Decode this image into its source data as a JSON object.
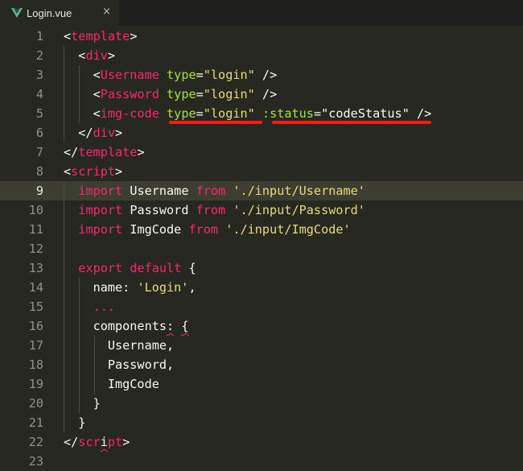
{
  "tab": {
    "title": "Login.vue",
    "close_glyph": "×",
    "icon": "vue-logo-icon"
  },
  "colors": {
    "background": "#272822",
    "keyword": "#f92672",
    "attribute": "#a6e22e",
    "string": "#e6db74",
    "text": "#f8f8f2",
    "highlight_underline": "#ff1a1a"
  },
  "active_line": 9,
  "lines": [
    {
      "n": "1",
      "tokens": [
        [
          "t",
          "<"
        ],
        [
          "p",
          "template"
        ],
        [
          "t",
          ">"
        ]
      ]
    },
    {
      "n": "2",
      "tokens": [
        [
          "t",
          "  <"
        ],
        [
          "p",
          "div"
        ],
        [
          "t",
          ">"
        ]
      ]
    },
    {
      "n": "3",
      "tokens": [
        [
          "t",
          "    <"
        ],
        [
          "p",
          "Username"
        ],
        [
          "t",
          " "
        ],
        [
          "g",
          "type"
        ],
        [
          "t",
          "="
        ],
        [
          "y",
          "\"login\""
        ],
        [
          "t",
          " />"
        ]
      ]
    },
    {
      "n": "4",
      "tokens": [
        [
          "t",
          "    <"
        ],
        [
          "p",
          "Password"
        ],
        [
          "t",
          " "
        ],
        [
          "g",
          "type"
        ],
        [
          "t",
          "="
        ],
        [
          "y",
          "\"login\""
        ],
        [
          "t",
          " />"
        ]
      ]
    },
    {
      "n": "5",
      "tokens": [
        [
          "t",
          "    <"
        ],
        [
          "p",
          "img-code"
        ],
        [
          "t",
          " "
        ],
        [
          "g",
          "type"
        ],
        [
          "t",
          "="
        ],
        [
          "y",
          "\"login\""
        ],
        [
          "t",
          " "
        ],
        [
          "g",
          ":status"
        ],
        [
          "t",
          "=\""
        ],
        [
          "t",
          "codeStatus"
        ],
        [
          "t",
          "\" />"
        ]
      ]
    },
    {
      "n": "6",
      "tokens": [
        [
          "t",
          "  </"
        ],
        [
          "p",
          "div"
        ],
        [
          "t",
          ">"
        ]
      ]
    },
    {
      "n": "7",
      "tokens": [
        [
          "t",
          "</"
        ],
        [
          "p",
          "template"
        ],
        [
          "t",
          ">"
        ]
      ]
    },
    {
      "n": "8",
      "tokens": [
        [
          "t",
          "<"
        ],
        [
          "p",
          "script"
        ],
        [
          "t",
          ">"
        ]
      ]
    },
    {
      "n": "9",
      "tokens": [
        [
          "t",
          "  "
        ],
        [
          "p",
          "import"
        ],
        [
          "t",
          " Username "
        ],
        [
          "p",
          "from"
        ],
        [
          "t",
          " "
        ],
        [
          "y",
          "'./input/Username'"
        ]
      ]
    },
    {
      "n": "10",
      "tokens": [
        [
          "t",
          "  "
        ],
        [
          "p",
          "import"
        ],
        [
          "t",
          " Password "
        ],
        [
          "p",
          "from"
        ],
        [
          "t",
          " "
        ],
        [
          "y",
          "'./input/Password'"
        ]
      ]
    },
    {
      "n": "11",
      "tokens": [
        [
          "t",
          "  "
        ],
        [
          "p",
          "import"
        ],
        [
          "t",
          " ImgCode "
        ],
        [
          "p",
          "from"
        ],
        [
          "t",
          " "
        ],
        [
          "y",
          "'./input/ImgCode'"
        ]
      ]
    },
    {
      "n": "12",
      "tokens": []
    },
    {
      "n": "13",
      "tokens": [
        [
          "t",
          "  "
        ],
        [
          "p",
          "export"
        ],
        [
          "t",
          " "
        ],
        [
          "p",
          "default"
        ],
        [
          "t",
          " {"
        ]
      ]
    },
    {
      "n": "14",
      "tokens": [
        [
          "t",
          "    name: "
        ],
        [
          "y",
          "'Login'"
        ],
        [
          "t",
          ","
        ]
      ]
    },
    {
      "n": "15",
      "tokens": [
        [
          "t",
          "    "
        ],
        [
          "p",
          "..."
        ]
      ]
    },
    {
      "n": "16",
      "tokens": [
        [
          "t",
          "    components"
        ],
        [
          "sq",
          ":"
        ],
        [
          "t",
          " "
        ],
        [
          "sq",
          "{"
        ]
      ]
    },
    {
      "n": "17",
      "tokens": [
        [
          "t",
          "      Username,"
        ]
      ]
    },
    {
      "n": "18",
      "tokens": [
        [
          "t",
          "      Password,"
        ]
      ]
    },
    {
      "n": "19",
      "tokens": [
        [
          "t",
          "      ImgCode"
        ]
      ]
    },
    {
      "n": "20",
      "tokens": [
        [
          "t",
          "    }"
        ]
      ]
    },
    {
      "n": "21",
      "tokens": [
        [
          "t",
          "  }"
        ]
      ]
    },
    {
      "n": "22",
      "tokens": [
        [
          "t",
          "</"
        ],
        [
          "p",
          "scr"
        ],
        [
          "sq",
          "i"
        ],
        [
          "p",
          "pt"
        ],
        [
          "t",
          ">"
        ]
      ]
    },
    {
      "n": "23",
      "tokens": []
    }
  ]
}
